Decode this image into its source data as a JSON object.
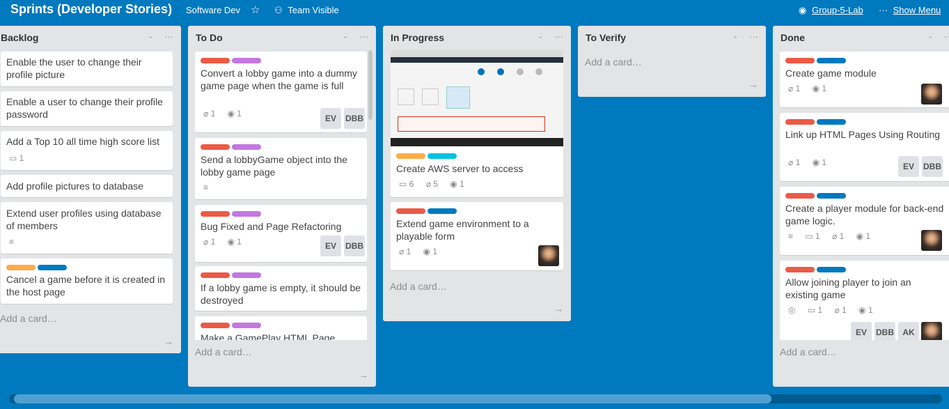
{
  "header": {
    "board_title": "Sprints (Developer Stories)",
    "team": "Software Dev",
    "visibility": "Team Visible",
    "repo": "Group-5-Lab",
    "menu": "Show Menu"
  },
  "lists": {
    "backlog": {
      "title": "Backlog",
      "cards": [
        {
          "title": "Enable the user to change their profile picture"
        },
        {
          "title": "Enable a user to change their profile password"
        },
        {
          "title": "Add a Top 10 all time high score list",
          "comments": "1"
        },
        {
          "title": "Add profile pictures to database"
        },
        {
          "title": "Extend user profiles using database of members"
        },
        {
          "title": "Cancel a game before it is created in the host page"
        }
      ],
      "add_card": "Add a card…"
    },
    "todo": {
      "title": "To Do",
      "cards": [
        {
          "title": "Convert a lobby game into a dummy game page when the game is full",
          "attachments": "1",
          "github": "1",
          "members": [
            "EV",
            "DBB"
          ]
        },
        {
          "title": "Send a lobbyGame object into the lobby game page"
        },
        {
          "title": "Bug Fixed and Page Refactoring",
          "attachments": "1",
          "github": "1",
          "members": [
            "EV",
            "DBB"
          ]
        },
        {
          "title": "If a lobby game is empty, it should be destroyed"
        },
        {
          "title": "Make a GamePlay HTML Page"
        }
      ],
      "add_card": "Add a card…"
    },
    "inprogress": {
      "title": "In Progress",
      "cards": [
        {
          "title": "Create AWS server to access",
          "comments": "6",
          "attachments": "5",
          "github": "1"
        },
        {
          "title": "Extend game environment to a playable form",
          "attachments": "1",
          "github": "1"
        }
      ],
      "add_card": "Add a card…"
    },
    "verify": {
      "title": "To Verify",
      "add_card": "Add a card…"
    },
    "done": {
      "title": "Done",
      "cards": [
        {
          "title": "Create game module",
          "attachments": "1",
          "github": "1"
        },
        {
          "title": "Link up HTML Pages Using Routing",
          "attachments": "1",
          "github": "1",
          "members": [
            "EV",
            "DBB"
          ]
        },
        {
          "title": "Create a player module for back-end game logic.",
          "comments": "1",
          "attachments": "1",
          "github": "1"
        },
        {
          "title": "Allow joining player to join an existing game",
          "comments": "1",
          "attachments": "1",
          "github": "1",
          "members": [
            "EV",
            "DBB",
            "AK"
          ]
        }
      ],
      "add_card": "Add a card…"
    }
  },
  "colors": {
    "board_bg": "#0079bf",
    "label_red": "#eb5a46",
    "label_purple": "#c377e0",
    "label_blue": "#0079bf",
    "label_orange": "#ffab4a",
    "label_sky": "#00c2e0"
  },
  "icons": [
    "github-icon",
    "star-icon",
    "team-icon",
    "attachment-icon",
    "comment-icon",
    "description-icon",
    "watch-icon",
    "more-icon"
  ]
}
